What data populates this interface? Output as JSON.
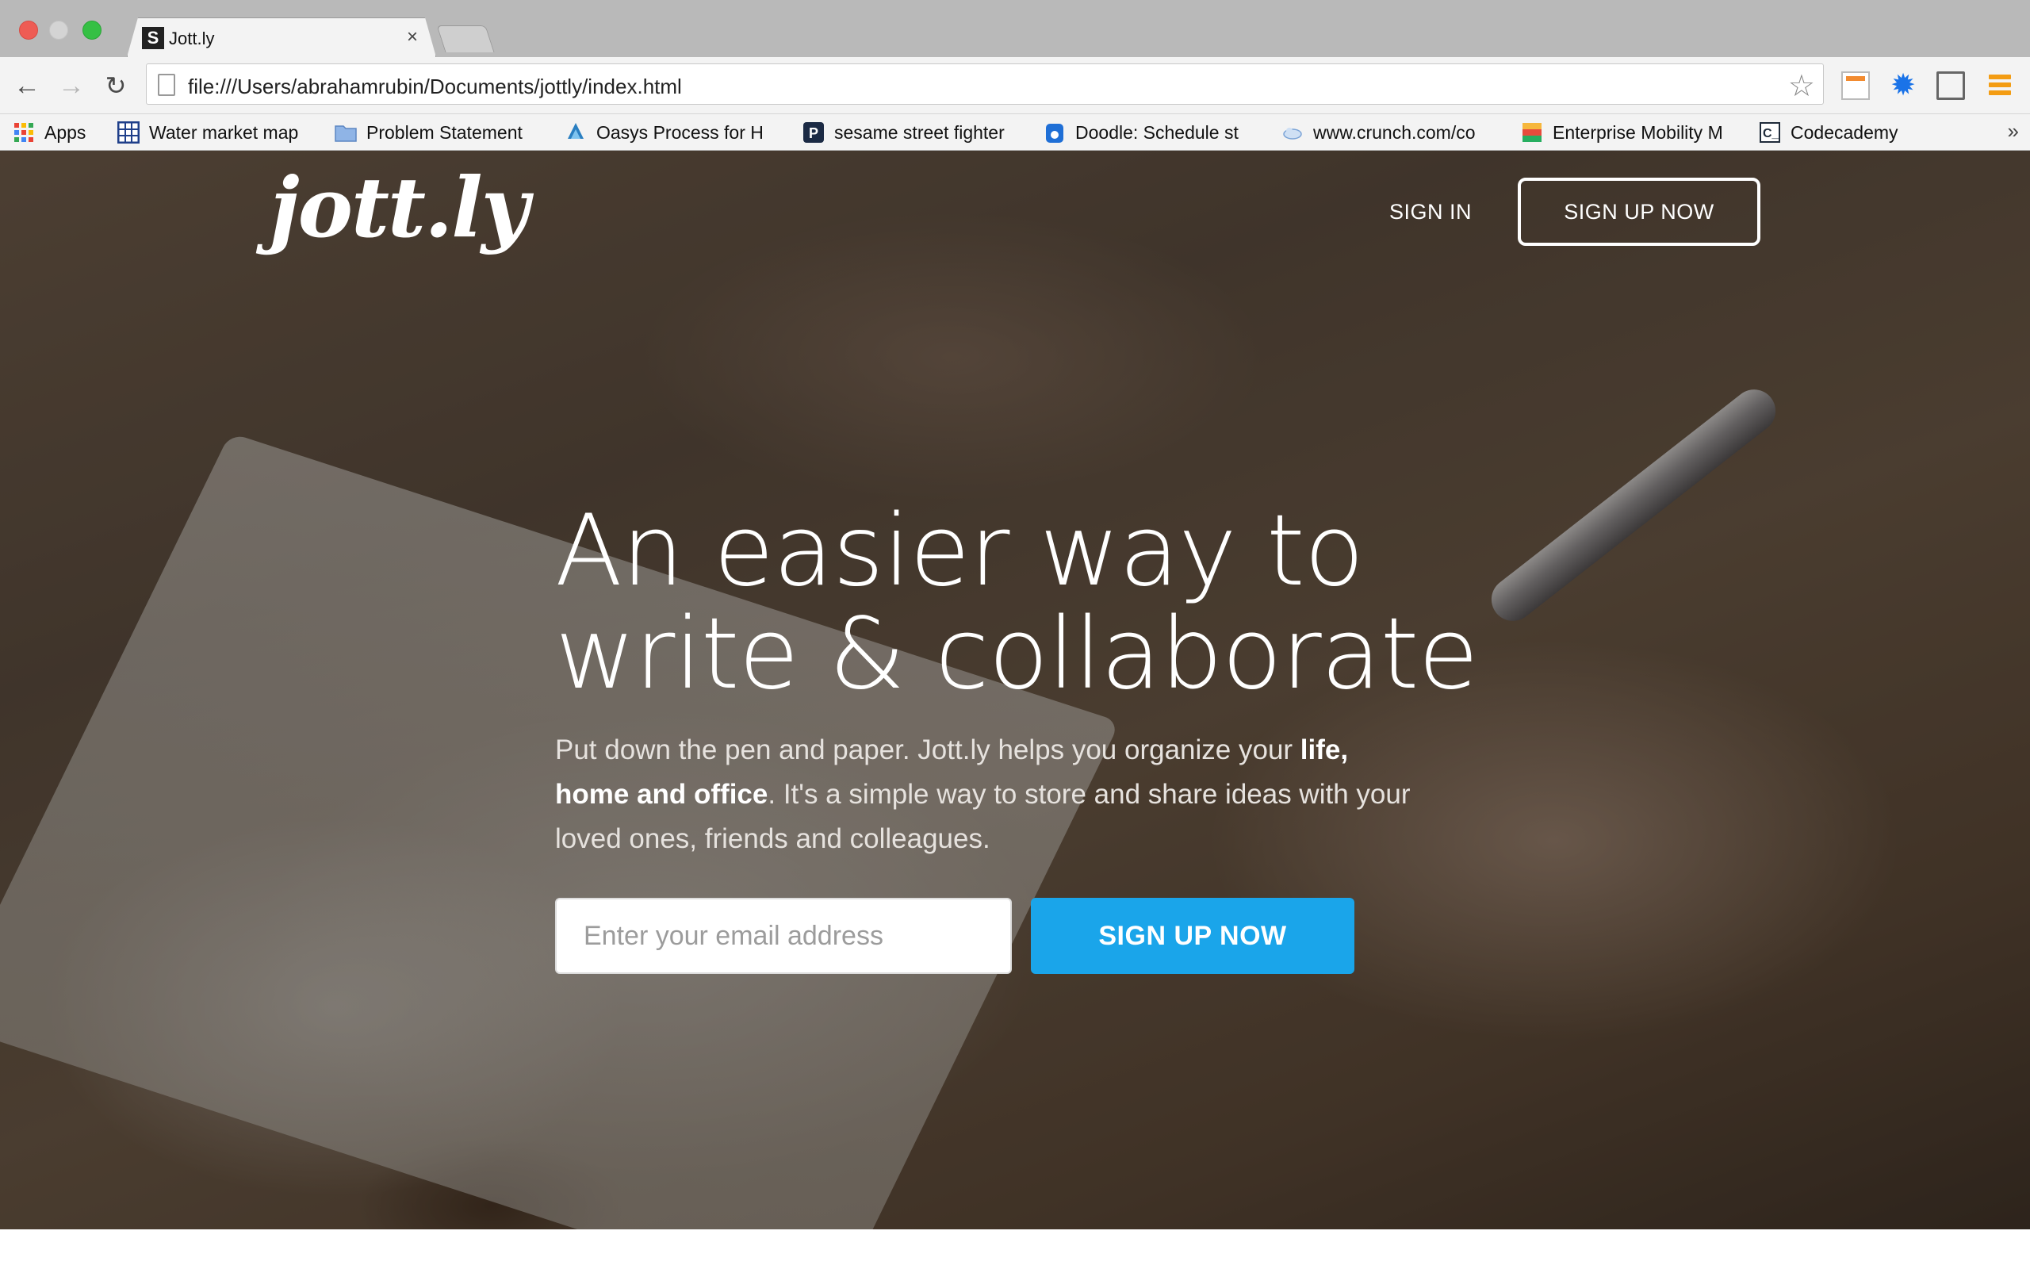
{
  "browser": {
    "tab": {
      "favicon": "S",
      "title": "Jott.ly",
      "close": "×"
    },
    "address": {
      "url": "file:///Users/abrahamrubin/Documents/jottly/index.html"
    },
    "nav": {
      "back": "←",
      "forward": "→",
      "reload": "↻",
      "star": "☆",
      "gear": "✹"
    },
    "bookmarks": [
      {
        "label": "Apps",
        "icon": "apps-grid-icon"
      },
      {
        "label": "Water market map",
        "icon": "grid-sheet-icon"
      },
      {
        "label": "Problem Statement",
        "icon": "folder-icon"
      },
      {
        "label": "Oasys Process for H",
        "icon": "drop-icon"
      },
      {
        "label": "sesame street fighter",
        "icon": "p-icon"
      },
      {
        "label": "Doodle: Schedule st",
        "icon": "doodle-icon"
      },
      {
        "label": "www.crunch.com/co",
        "icon": "cloud-icon"
      },
      {
        "label": "Enterprise Mobility M",
        "icon": "colorful-icon"
      },
      {
        "label": "Codecademy",
        "icon": "codecademy-icon"
      }
    ],
    "more": "»"
  },
  "site": {
    "logo": "jott.ly",
    "nav": {
      "sign_in": "SIGN IN",
      "sign_up": "SIGN UP NOW"
    },
    "hero": {
      "headline_line1": "An easier way to",
      "headline_line2": "write & collaborate",
      "sub_part1": "Put down the pen and paper. Jott.ly helps you organize your ",
      "sub_bold": "life, home and office",
      "sub_part2": ". It's a simple way to store and share ideas with your loved ones, friends and colleagues.",
      "email_placeholder": "Enter your email address",
      "cta": "SIGN UP NOW"
    }
  },
  "colors": {
    "cta": "#1aa5ea",
    "menu_accent": "#f39c12"
  }
}
